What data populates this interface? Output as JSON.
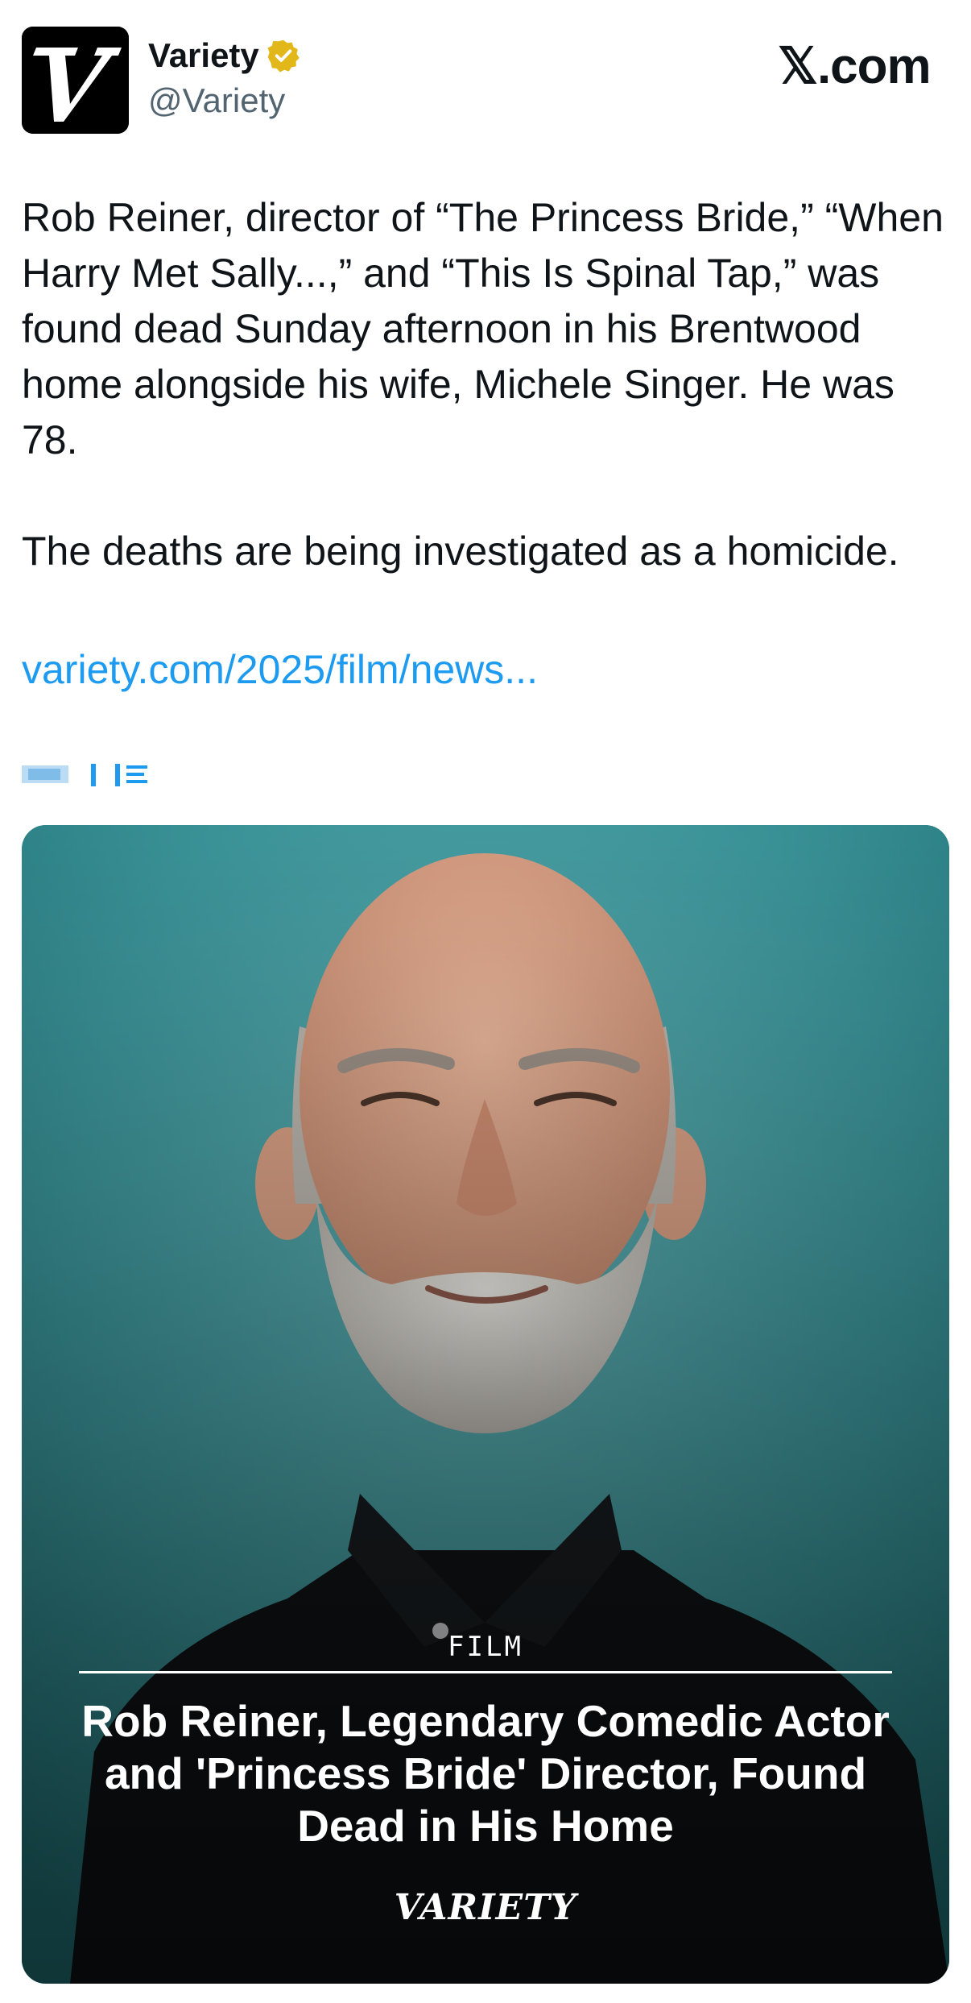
{
  "account": {
    "display_name": "Variety",
    "handle": "@Variety",
    "verified_badge_color": "#e2b719",
    "avatar_icon": "variety-v-logo"
  },
  "site": {
    "brand": "𝕏.com"
  },
  "tweet": {
    "paragraph1": "Rob Reiner, director of “The Princess Bride,” “When Harry Met Sally...,” and “This Is Spinal Tap,” was found dead Sunday afternoon in his Brentwood home alongside his wife, Michele Singer. He was 78.",
    "paragraph2": "The deaths are being investigated as a homicide.",
    "link": "variety.com/2025/film/news..."
  },
  "card": {
    "category": "FILM",
    "headline": "Rob Reiner, Legendary Comedic Actor and 'Princess Bride' Director, Found Dead in His Home",
    "logo": "VARIETY"
  },
  "colors": {
    "text": "#0f1419",
    "secondary": "#536471",
    "link": "#1d9bf0",
    "card_background": "#2c8c92"
  }
}
